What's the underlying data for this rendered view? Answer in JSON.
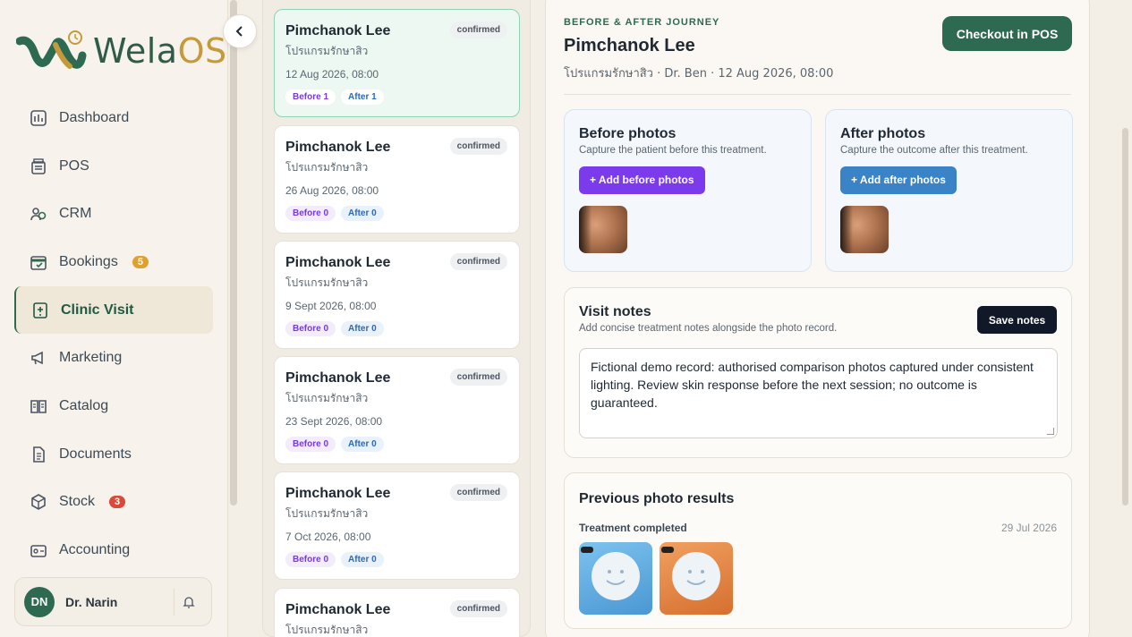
{
  "sidebar": {
    "logo_text": "WelaOS",
    "items": [
      {
        "label": "Dashboard",
        "icon": "dashboard-icon"
      },
      {
        "label": "POS",
        "icon": "pos-icon"
      },
      {
        "label": "CRM",
        "icon": "crm-icon"
      },
      {
        "label": "Bookings",
        "icon": "calendar-icon",
        "badge": "5"
      },
      {
        "label": "Clinic Visit",
        "icon": "clinic-icon",
        "active": true
      },
      {
        "label": "Marketing",
        "icon": "megaphone-icon"
      },
      {
        "label": "Catalog",
        "icon": "book-icon"
      },
      {
        "label": "Documents",
        "icon": "document-icon"
      },
      {
        "label": "Stock",
        "icon": "box-icon",
        "badge": "3"
      },
      {
        "label": "Accounting",
        "icon": "wallet-icon"
      }
    ],
    "user": {
      "initials": "DN",
      "name": "Dr. Narin"
    }
  },
  "visits": [
    {
      "name": "Pimchanok Lee",
      "status": "confirmed",
      "program": "โปรแกรมรักษาสิว",
      "date": "12 Aug 2026, 08:00",
      "before": "Before 1",
      "after": "After 1",
      "selected": true
    },
    {
      "name": "Pimchanok Lee",
      "status": "confirmed",
      "program": "โปรแกรมรักษาสิว",
      "date": "26 Aug 2026, 08:00",
      "before": "Before 0",
      "after": "After 0"
    },
    {
      "name": "Pimchanok Lee",
      "status": "confirmed",
      "program": "โปรแกรมรักษาสิว",
      "date": "9 Sept 2026, 08:00",
      "before": "Before 0",
      "after": "After 0"
    },
    {
      "name": "Pimchanok Lee",
      "status": "confirmed",
      "program": "โปรแกรมรักษาสิว",
      "date": "23 Sept 2026, 08:00",
      "before": "Before 0",
      "after": "After 0"
    },
    {
      "name": "Pimchanok Lee",
      "status": "confirmed",
      "program": "โปรแกรมรักษาสิว",
      "date": "7 Oct 2026, 08:00",
      "before": "Before 0",
      "after": "After 0"
    },
    {
      "name": "Pimchanok Lee",
      "status": "confirmed",
      "program": "โปรแกรมรักษาสิว",
      "date": "",
      "before": "",
      "after": ""
    }
  ],
  "detail": {
    "eyebrow": "BEFORE & AFTER JOURNEY",
    "title": "Pimchanok Lee",
    "subtitle": "โปรแกรมรักษาสิว · Dr. Ben · 12 Aug 2026, 08:00",
    "checkout_label": "Checkout in POS",
    "before": {
      "title": "Before photos",
      "desc": "Capture the patient before this treatment.",
      "button": "+ Add before photos"
    },
    "after": {
      "title": "After photos",
      "desc": "Capture the outcome after this treatment.",
      "button": "+ Add after photos"
    },
    "notes": {
      "title": "Visit notes",
      "desc": "Add concise treatment notes alongside the photo record.",
      "save_label": "Save notes",
      "value": "Fictional demo record: authorised comparison photos captured under consistent lighting. Review skin response before the next session; no outcome is guaranteed."
    },
    "previous": {
      "title": "Previous photo results",
      "label": "Treatment completed",
      "date": "29 Jul 2026"
    }
  },
  "colors": {
    "brand": "#2e6a52",
    "accent": "#c49a3a",
    "before": "#7c3aed",
    "after": "#3a83c6"
  }
}
